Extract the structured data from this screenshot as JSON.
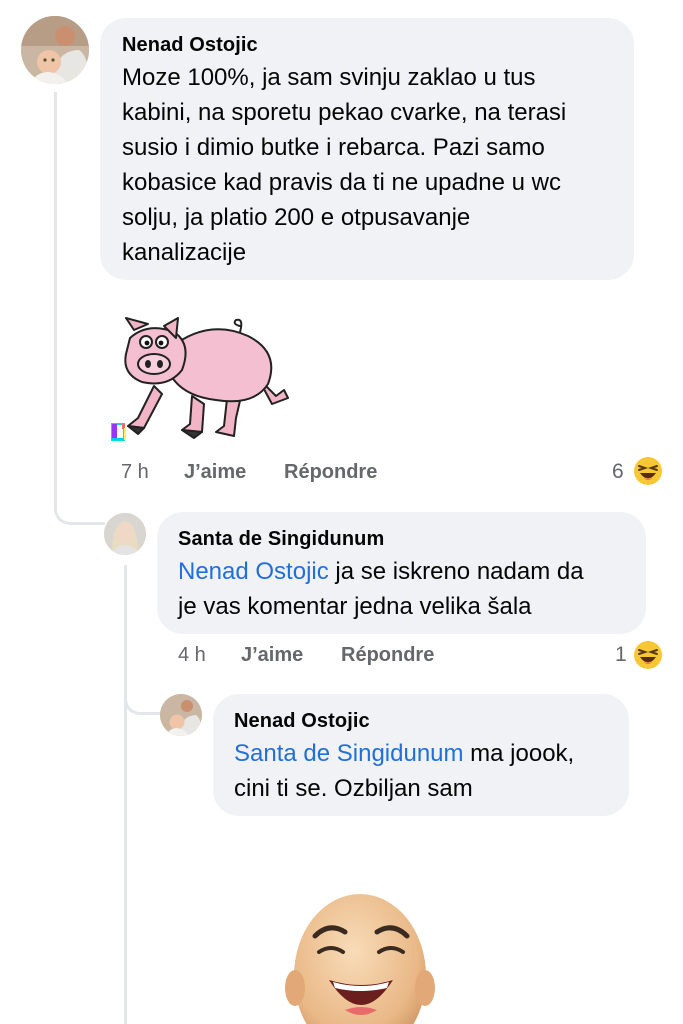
{
  "comments": [
    {
      "author": "Nenad Ostojic",
      "text": "Moze 100%, ja sam svinju zaklao u tus kabini, na sporetu pekao cvarke, na terasi susio i dimio butke i rebarca. Pazi samo kobasice kad pravis da ti ne upadne u wc solju, ja platio 200 e otpusavanje kanalizacije",
      "lines": [
        "Moze 100%, ja sam svinju zaklao u tus",
        "kabini, na sporetu pekao cvarke, na terasi",
        "susio i dimio butke i rebarca. Pazi samo",
        "kobasice kad pravis da ti ne upadne u wc",
        "solju, ja platio 200 e otpusavanje",
        "kanalizacije"
      ],
      "sticker": "pig-sticker",
      "time": "7 h",
      "like_label": "J’aime",
      "reply_label": "Répondre",
      "reaction_count": "6",
      "reaction_icon": "laughing-emoji-icon"
    },
    {
      "author": "Santa de Singidunum",
      "mention": "Nenad Ostojic",
      "line1_rest": " ja se iskreno nadam da",
      "line2": "je vas komentar jedna velika šala",
      "time": "4 h",
      "like_label": "J’aime",
      "reply_label": "Répondre",
      "reaction_count": "1",
      "reaction_icon": "laughing-emoji-icon"
    },
    {
      "author": "Nenad Ostojic",
      "mention": "Santa de Singidunum",
      "line1_rest": " ma joook,",
      "line2": "cini ti se. Ozbiljan sam",
      "sticker": "laughing-face-sticker"
    }
  ],
  "colors": {
    "bubble": "#f0f2f5",
    "mention": "#216fdb",
    "meta": "#65676b",
    "thread_line": "#e4e6eb"
  }
}
